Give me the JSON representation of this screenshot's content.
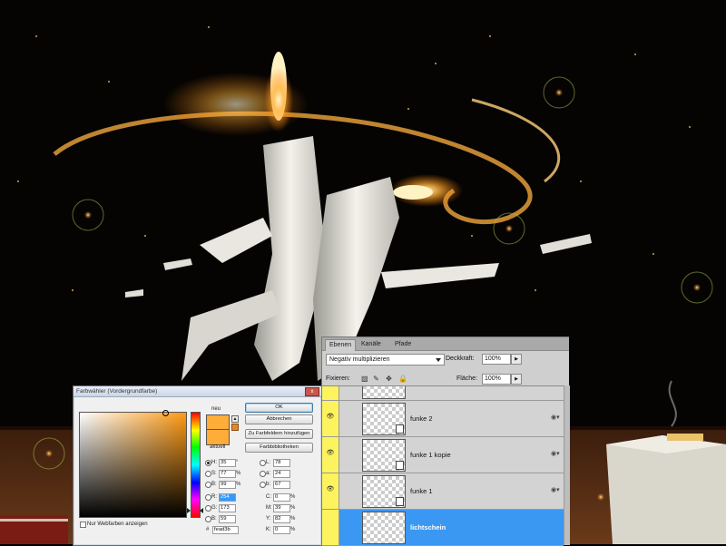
{
  "color_picker": {
    "title": "Farbwähler (Vordergrundfarbe)",
    "close": "x",
    "label_new": "neu",
    "label_current": "aktuell",
    "buttons": {
      "ok": "OK",
      "cancel": "Abbrechen",
      "add_swatch": "Zu Farbfeldern hinzufügen",
      "libraries": "Farbbibliotheken"
    },
    "fields": {
      "H": {
        "label": "H:",
        "value": "35",
        "unit": "°"
      },
      "S": {
        "label": "S:",
        "value": "77",
        "unit": "%"
      },
      "B": {
        "label": "B:",
        "value": "99",
        "unit": "%"
      },
      "R": {
        "label": "R:",
        "value": "254"
      },
      "G": {
        "label": "G:",
        "value": "173"
      },
      "Bl": {
        "label": "B:",
        "value": "59"
      },
      "L": {
        "label": "L:",
        "value": "78"
      },
      "a": {
        "label": "a:",
        "value": "24"
      },
      "b": {
        "label": "b:",
        "value": "67"
      },
      "C": {
        "label": "C:",
        "value": "0",
        "unit": "%"
      },
      "M": {
        "label": "M:",
        "value": "39",
        "unit": "%"
      },
      "Y": {
        "label": "Y:",
        "value": "82",
        "unit": "%"
      },
      "K": {
        "label": "K:",
        "value": "0",
        "unit": "%"
      }
    },
    "hex": {
      "label": "#",
      "value": "fead3b"
    },
    "web_only_label": "Nur Webfarben anzeigen",
    "new_color": "#fead3b",
    "current_color": "#fead3b"
  },
  "layers_panel": {
    "tabs": [
      "Ebenen",
      "Kanäle",
      "Pfade"
    ],
    "active_tab": "Ebenen",
    "blend_mode": "Negativ multiplizieren",
    "opacity_label": "Deckkraft:",
    "opacity": "100%",
    "lock_label": "Fixieren:",
    "fill_label": "Fläche:",
    "fill": "100%",
    "layers": [
      {
        "name": "funke 2",
        "selected": false
      },
      {
        "name": "funke 1 kopie",
        "selected": false
      },
      {
        "name": "funke 1",
        "selected": false
      },
      {
        "name": "lichtschein",
        "selected": true
      }
    ]
  },
  "colors": {
    "accent_selection": "#3a98f3",
    "visibility_column": "#fdf35e",
    "foreground_color": "#fead3b"
  }
}
